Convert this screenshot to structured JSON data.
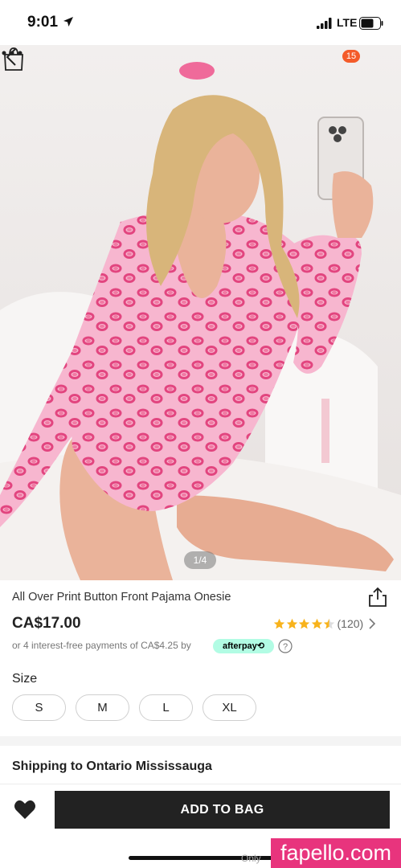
{
  "status_bar": {
    "time": "9:01",
    "carrier": "LTE"
  },
  "header": {
    "cart_count": "15"
  },
  "gallery": {
    "pager": "1/4"
  },
  "product": {
    "title": "All Over Print Button Front Pajama Onesie",
    "price": "CA$17.00",
    "rating_value": 4.5,
    "rating_count": "(120)",
    "installments_text": "or 4 interest-free payments of CA$4.25 by",
    "afterpay_label": "afterpay⟲"
  },
  "size": {
    "label": "Size",
    "options": [
      "S",
      "M",
      "L",
      "XL"
    ]
  },
  "shipping": {
    "label": "Shipping to Ontario Mississauga"
  },
  "bottom_bar": {
    "add_to_bag_label": "ADD TO BAG"
  },
  "watermark": {
    "text": "fapello.com",
    "small_text": "Only"
  },
  "colors": {
    "accent": "#222222",
    "badge": "#f45b2a",
    "star": "#f8b31c",
    "afterpay": "#b2fce4",
    "watermark": "#e8347d"
  },
  "icons": [
    "back-icon",
    "shopping-bag-icon",
    "more-icon",
    "share-icon",
    "star-icon",
    "chevron-right-icon",
    "help-icon",
    "heart-icon",
    "location-arrow-icon",
    "signal-icon",
    "battery-icon"
  ]
}
